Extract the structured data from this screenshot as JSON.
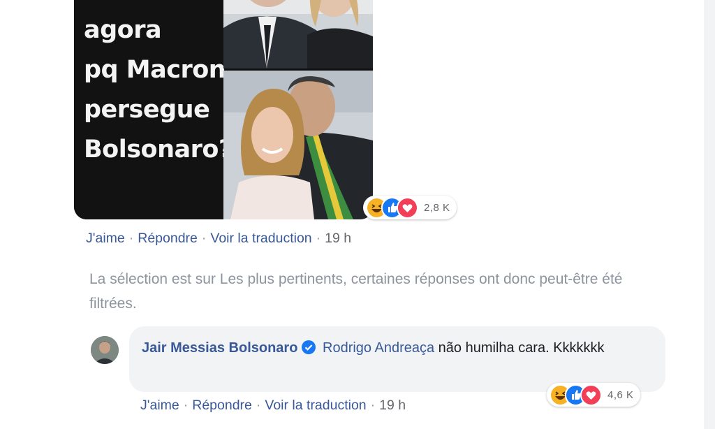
{
  "meme": {
    "lines": [
      "agora",
      "pq Macron",
      "persegue",
      "Bolsonaro?"
    ]
  },
  "comment1": {
    "reaction_count": "2,8 K",
    "actions": {
      "like": "J'aime",
      "reply": "Répondre",
      "translate": "Voir la traduction",
      "time": "19 h"
    }
  },
  "filter_notice": "La sélection est sur Les plus pertinents, certaines réponses ont donc peut-être été filtrées.",
  "reply": {
    "author": "Jair Messias Bolsonaro",
    "mention": "Rodrigo Andreaça",
    "text": " não humilha cara. Kkkkkkk",
    "reaction_count": "4,6 K",
    "actions": {
      "like": "J'aime",
      "reply": "Répondre",
      "translate": "Voir la traduction",
      "time": "19 h"
    }
  },
  "colors": {
    "link": "#385898",
    "meta": "#65676b",
    "bubble": "#f2f3f5",
    "haha": "#f7b125",
    "like": "#1877f2",
    "love": "#f33e58"
  },
  "icons": [
    "haha-reaction-icon",
    "like-reaction-icon",
    "love-reaction-icon",
    "verified-badge-icon"
  ]
}
